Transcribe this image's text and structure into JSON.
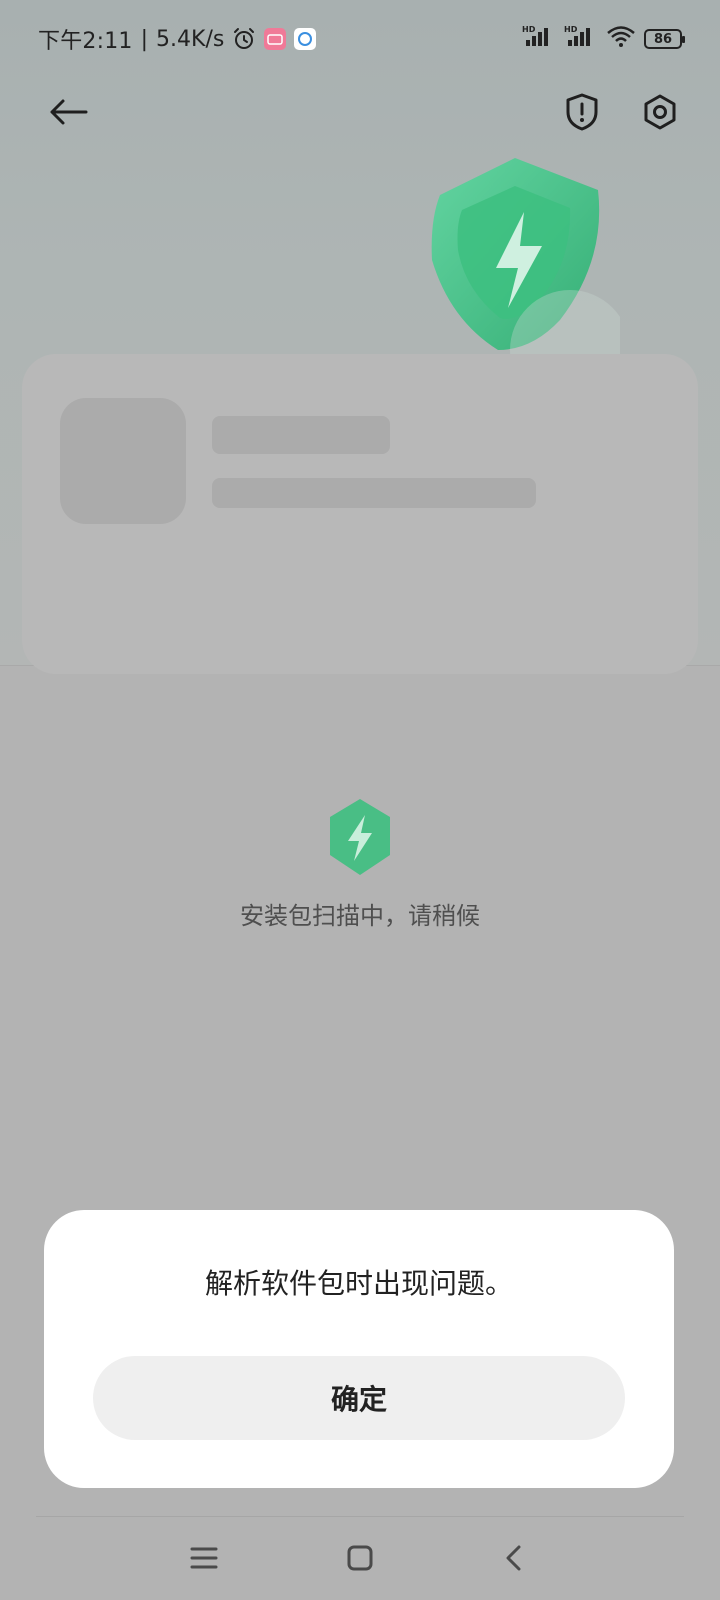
{
  "status_bar": {
    "time": "下午2:11",
    "separator": "|",
    "network_speed": "5.4K/s",
    "signal_1_label": "HD",
    "signal_2_label": "HD",
    "battery_level": "86",
    "icons": [
      "alarm-icon",
      "app-notification-icon",
      "cloud-app-icon",
      "signal-icon",
      "signal-icon",
      "wifi-icon",
      "battery-icon"
    ]
  },
  "header": {
    "icons": [
      "back-arrow-icon",
      "shield-alert-icon",
      "settings-icon"
    ]
  },
  "scan": {
    "message": "安装包扫描中，请稍候"
  },
  "dialog": {
    "message": "解析软件包时出现问题。",
    "confirm_label": "确定"
  },
  "system_nav": {
    "icons": [
      "menu-icon",
      "home-icon",
      "back-icon"
    ]
  },
  "colors": {
    "accent_green": "#3dbf80",
    "dialog_bg": "#ffffff",
    "button_bg": "#efefef",
    "scrim": "#b3b3b3"
  }
}
